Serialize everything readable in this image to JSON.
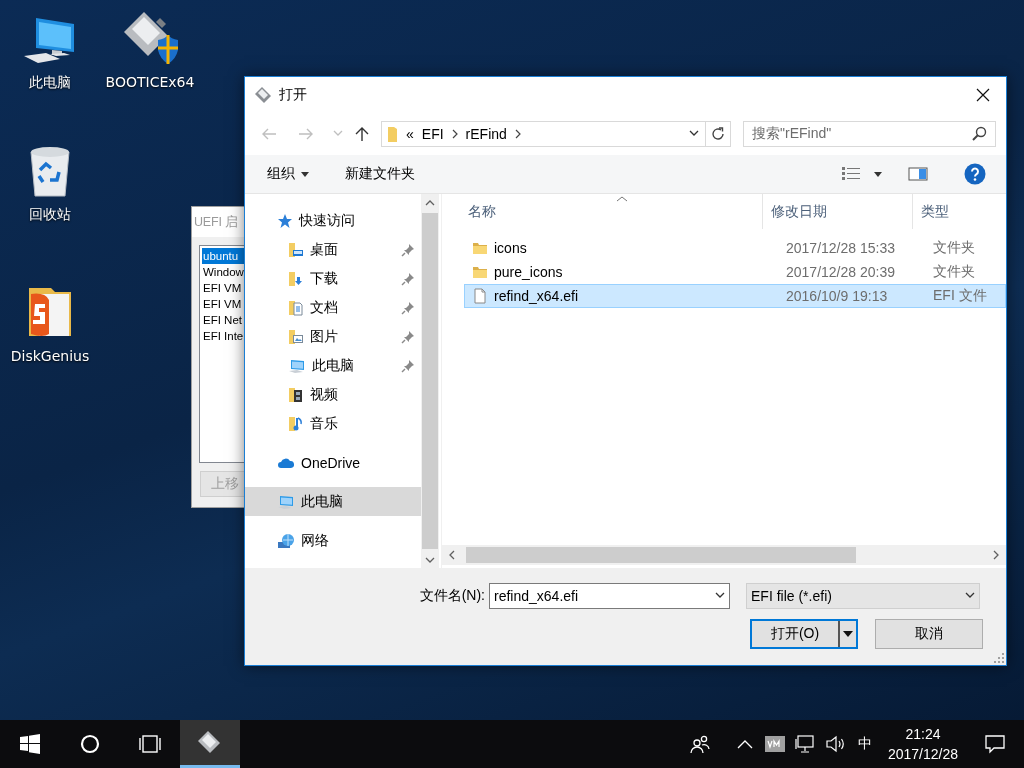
{
  "desktop_icons": [
    {
      "label": "此电脑",
      "kind": "computer"
    },
    {
      "label": "BOOTICEx64",
      "kind": "floppy"
    },
    {
      "label": "回收站",
      "kind": "bin"
    },
    {
      "label": "DiskGenius",
      "kind": "diskgenius"
    }
  ],
  "background_window": {
    "title": "UEFI 启",
    "boot_entries": [
      {
        "label": "ubuntu",
        "selected": true
      },
      {
        "label": "Window",
        "selected": false
      },
      {
        "label": "EFI VM",
        "selected": false
      },
      {
        "label": "EFI VM",
        "selected": false
      },
      {
        "label": "EFI Net",
        "selected": false
      },
      {
        "label": "EFI Inte",
        "selected": false
      }
    ],
    "move_up_button": {
      "label": "上移",
      "disabled": true
    }
  },
  "dialog": {
    "title": "打开",
    "address": {
      "overflow": "«",
      "path": [
        "EFI",
        "rEFind"
      ]
    },
    "search": {
      "placeholder": "搜索\"rEFind\""
    },
    "toolbar": {
      "organize": "组织",
      "new_folder": "新建文件夹"
    },
    "nav": [
      {
        "label": "快速访问",
        "kind": "star",
        "selected": false,
        "children": [
          {
            "label": "桌面",
            "kind": "desktop",
            "pinned": true,
            "selected": false
          },
          {
            "label": "下载",
            "kind": "download",
            "pinned": true,
            "selected": false
          },
          {
            "label": "文档",
            "kind": "document",
            "pinned": true,
            "selected": false
          },
          {
            "label": "图片",
            "kind": "picture",
            "pinned": true,
            "selected": false
          },
          {
            "label": "此电脑",
            "kind": "computer",
            "pinned": true,
            "selected": false
          },
          {
            "label": "视频",
            "kind": "video",
            "pinned": false,
            "selected": false
          },
          {
            "label": "音乐",
            "kind": "music",
            "pinned": false,
            "selected": false
          }
        ]
      },
      {
        "label": "OneDrive",
        "kind": "cloud",
        "selected": false
      },
      {
        "label": "此电脑",
        "kind": "computer",
        "selected": true
      },
      {
        "label": "网络",
        "kind": "network",
        "selected": false
      }
    ],
    "columns": [
      "名称",
      "修改日期",
      "类型"
    ],
    "files": [
      {
        "name": "icons",
        "modified": "2017/12/28 15:33",
        "type": "文件夹",
        "kind": "folder",
        "selected": false
      },
      {
        "name": "pure_icons",
        "modified": "2017/12/28 20:39",
        "type": "文件夹",
        "kind": "folder",
        "selected": false
      },
      {
        "name": "refind_x64.efi",
        "modified": "2016/10/9 19:13",
        "type": "EFI 文件",
        "kind": "file",
        "selected": true
      }
    ],
    "filename": {
      "label": "文件名(N):",
      "value": "refind_x64.efi"
    },
    "filetype": "EFI file (*.efi)",
    "buttons": {
      "open": "打开(O)",
      "cancel": "取消"
    }
  },
  "taskbar": {
    "apps": [
      {
        "kind": "floppy",
        "active": true
      }
    ],
    "input_method": "中",
    "time": "21:24",
    "date": "2017/12/28"
  }
}
